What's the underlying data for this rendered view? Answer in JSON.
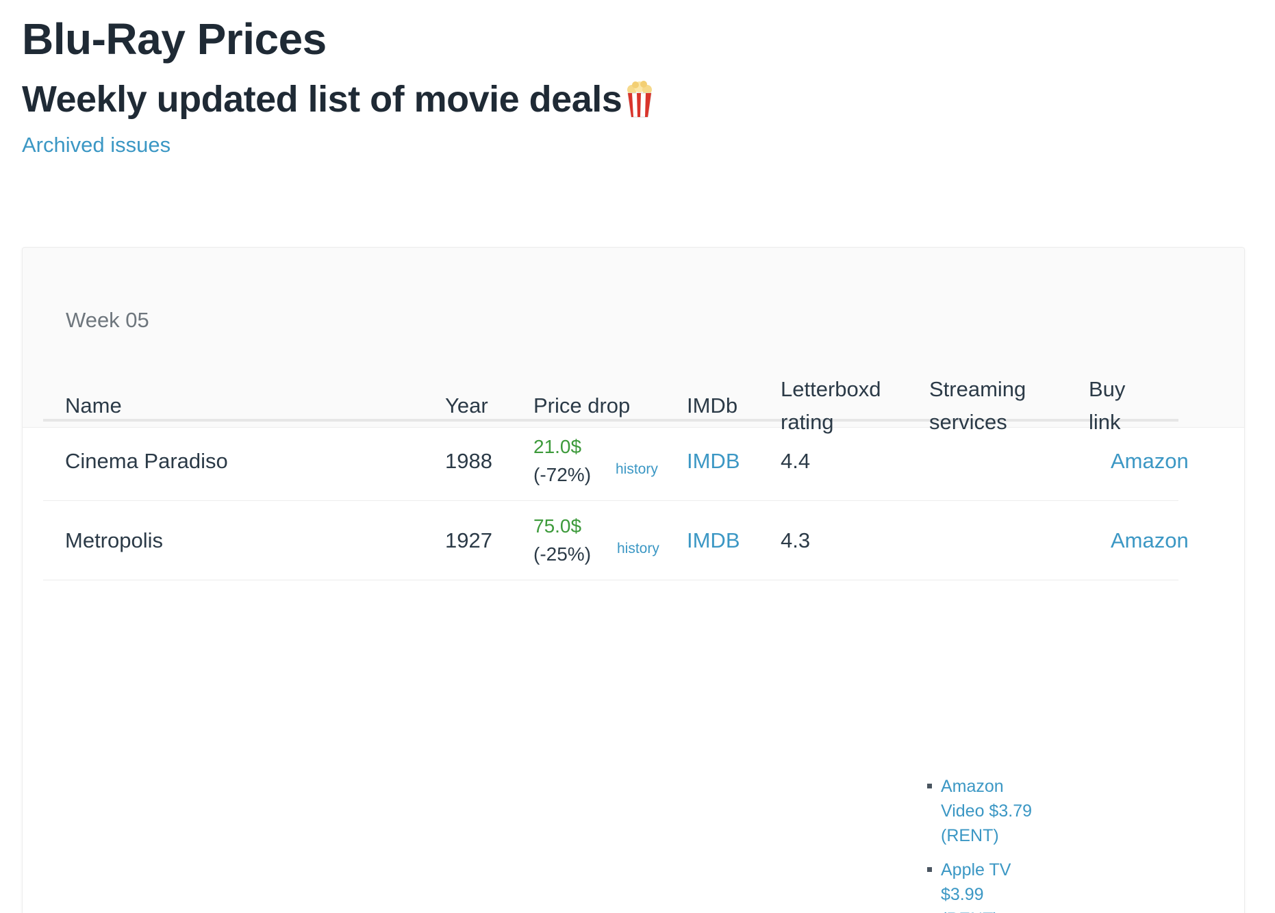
{
  "header": {
    "title": "Blu-Ray Prices",
    "subtitle": "Weekly updated list of movie deals",
    "subtitle_icon": "popcorn-icon",
    "archive_link": "Archived issues"
  },
  "issue": {
    "week_label": "Week 05"
  },
  "table": {
    "columns": {
      "name": "Name",
      "year": "Year",
      "price_drop": "Price drop",
      "imdb": "IMDb",
      "letterboxd_line1": "Letterboxd",
      "letterboxd_line2": "rating",
      "streaming_line1": "Streaming",
      "streaming_line2": "services",
      "buy_line1": "Buy",
      "buy_line2": "link"
    },
    "rows": [
      {
        "name": "Cinema Paradiso",
        "year": "1988",
        "price": "21.0$",
        "drop": "(-72%)",
        "history": "history",
        "imdb": "IMDB",
        "letterboxd": "4.4",
        "buy": "Amazon"
      },
      {
        "name": "Metropolis",
        "year": "1927",
        "price": "75.0$",
        "drop": "(-25%)",
        "history": "history",
        "imdb": "IMDB",
        "letterboxd": "4.3",
        "buy": "Amazon"
      }
    ],
    "streaming_partial": [
      {
        "line1": "Amazon",
        "line2": "Video $3.79",
        "line3": "(RENT)"
      },
      {
        "line1": "Apple TV",
        "line2": "$3.99",
        "line3": "(RENT)"
      }
    ]
  },
  "colors": {
    "link": "#3b97c4",
    "price_green": "#3d9a3b",
    "heading": "#1f2a35",
    "muted": "#6e767d"
  }
}
